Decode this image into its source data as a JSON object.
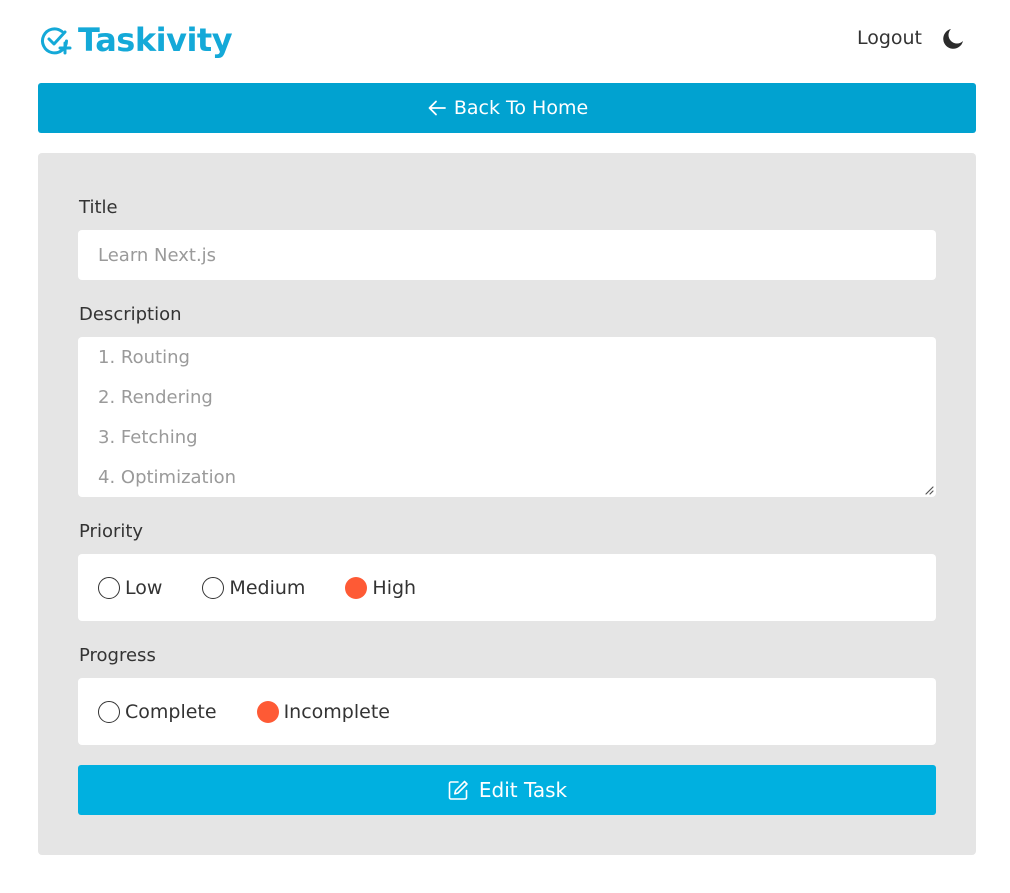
{
  "header": {
    "brand": "Taskivity",
    "logout_label": "Logout",
    "brand_color": "#14a9d8",
    "theme_icon": "moon-icon",
    "logo_icon": "check-circle-plus-icon"
  },
  "back_button": {
    "label": "Back To Home",
    "icon": "arrow-left-icon",
    "color": "#01a2d0"
  },
  "form": {
    "title": {
      "label": "Title",
      "placeholder": "Learn Next.js",
      "value": ""
    },
    "description": {
      "label": "Description",
      "placeholder_lines": [
        "1. Routing",
        "2. Rendering",
        "3. Fetching",
        "4. Optimization"
      ]
    },
    "priority": {
      "label": "Priority",
      "options": [
        "Low",
        "Medium",
        "High"
      ],
      "selected": "High"
    },
    "progress": {
      "label": "Progress",
      "options": [
        "Complete",
        "Incomplete"
      ],
      "selected": "Incomplete"
    },
    "submit": {
      "label": "Edit Task",
      "icon": "edit-icon",
      "color": "#00b0e0"
    },
    "accent_color": "#fe5a35",
    "panel_color": "#e5e5e5"
  }
}
